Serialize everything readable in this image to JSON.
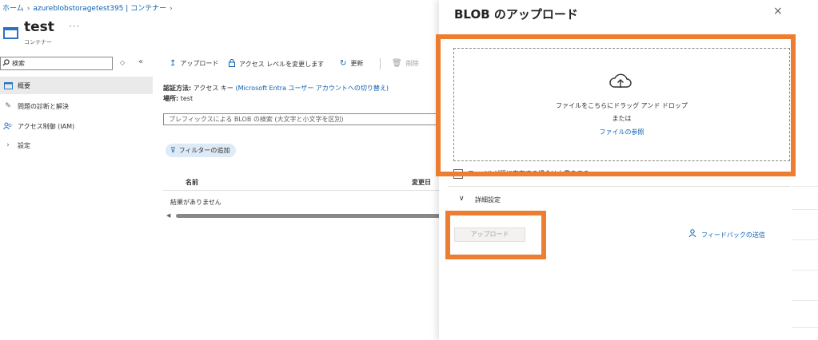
{
  "breadcrumb": {
    "items": [
      "ホーム",
      "azureblobstoragetest395 | コンテナー"
    ],
    "trailing": "›"
  },
  "header": {
    "title": "test",
    "subtitle": "コンテナー",
    "more": "···"
  },
  "sidebar": {
    "search_value": "検索",
    "items": [
      {
        "label": "概要",
        "icon": "overview-icon"
      },
      {
        "label": "問題の診断と解決",
        "icon": "wrench-icon"
      },
      {
        "label": "アクセス制御 (IAM)",
        "icon": "people-icon"
      },
      {
        "label": "設定",
        "icon": "chevron-right-icon"
      }
    ]
  },
  "toolbar": {
    "upload": "アップロード",
    "change_access": "アクセス レベルを変更します",
    "refresh": "更新",
    "delete": "削除"
  },
  "main": {
    "auth_label": "認証方法:",
    "auth_value": "アクセス キー",
    "auth_link": "(Microsoft Entra ユーザー アカウントへの切り替え)",
    "location_label": "場所:",
    "location_value": "test",
    "prefix_search_placeholder": "プレフィックスによる BLOB の検索 (大文字と小文字を区別)",
    "add_filter": "フィルターの追加",
    "columns": [
      "名前",
      "変更日"
    ],
    "empty": "結果がありません"
  },
  "panel": {
    "title": "BLOB のアップロード",
    "close": "×",
    "drop_text": "ファイルをこちらにドラッグ アンド ドロップ",
    "or_text": "または",
    "browse_link": "ファイルの参照",
    "overwrite_label": "ファイルが既に存在する場合は上書きする",
    "advanced": "詳細設定",
    "upload_button": "アップロード",
    "feedback": "フィードバックの送信"
  },
  "colors": {
    "accent": "#0a5fb0",
    "highlight": "#ed7d31"
  }
}
